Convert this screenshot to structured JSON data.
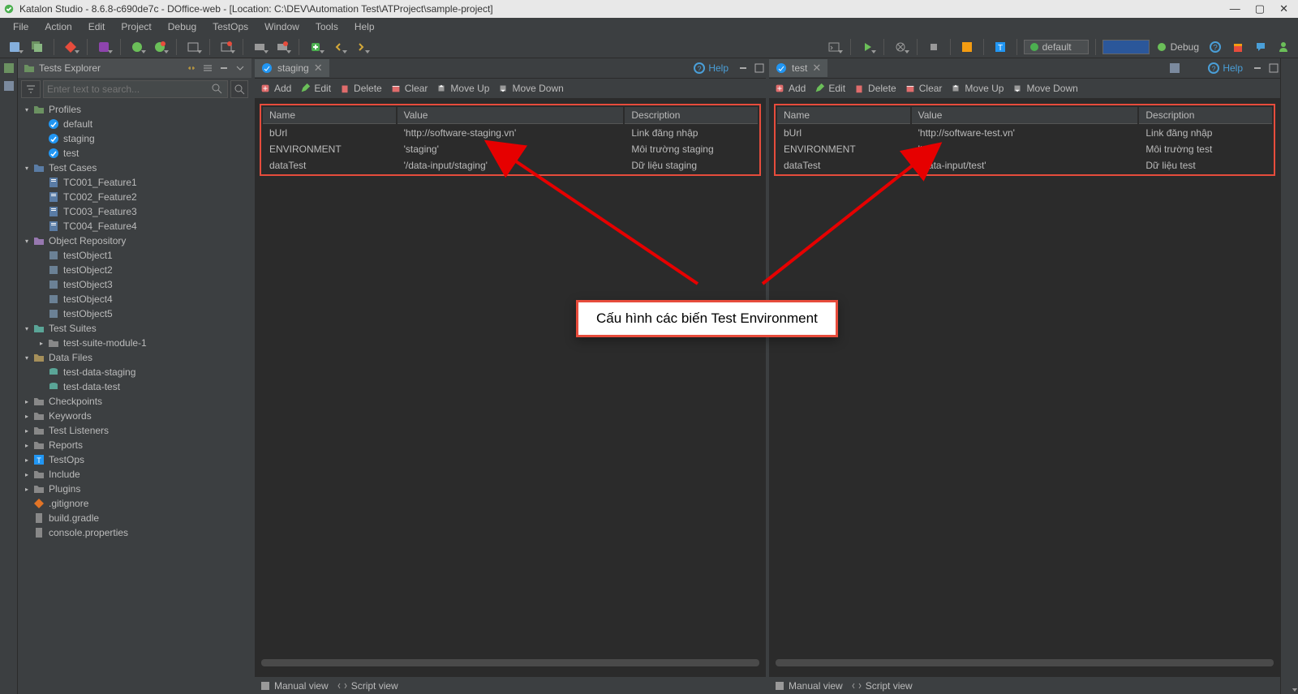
{
  "title": "Katalon Studio - 8.6.8-c690de7c - DOffice-web - [Location: C:\\DEV\\Automation Test\\ATProject\\sample-project]",
  "menubar": [
    "File",
    "Action",
    "Edit",
    "Project",
    "Debug",
    "TestOps",
    "Window",
    "Tools",
    "Help"
  ],
  "toolbar": {
    "profile_selected": "default",
    "debug_label": "Debug"
  },
  "explorer": {
    "title": "Tests Explorer",
    "search_placeholder": "Enter text to search...",
    "tree": [
      {
        "d": 0,
        "exp": "v",
        "icon": "folder-green",
        "label": "Profiles"
      },
      {
        "d": 1,
        "exp": "",
        "icon": "profile",
        "label": "default"
      },
      {
        "d": 1,
        "exp": "",
        "icon": "profile",
        "label": "staging"
      },
      {
        "d": 1,
        "exp": "",
        "icon": "profile",
        "label": "test"
      },
      {
        "d": 0,
        "exp": "v",
        "icon": "folder-blue",
        "label": "Test Cases"
      },
      {
        "d": 1,
        "exp": "",
        "icon": "tc",
        "label": "TC001_Feature1"
      },
      {
        "d": 1,
        "exp": "",
        "icon": "tc",
        "label": "TC002_Feature2"
      },
      {
        "d": 1,
        "exp": "",
        "icon": "tc",
        "label": "TC003_Feature3"
      },
      {
        "d": 1,
        "exp": "",
        "icon": "tc",
        "label": "TC004_Feature4"
      },
      {
        "d": 0,
        "exp": "v",
        "icon": "folder-purple",
        "label": "Object Repository"
      },
      {
        "d": 1,
        "exp": "",
        "icon": "obj",
        "label": "testObject1"
      },
      {
        "d": 1,
        "exp": "",
        "icon": "obj",
        "label": "testObject2"
      },
      {
        "d": 1,
        "exp": "",
        "icon": "obj",
        "label": "testObject3"
      },
      {
        "d": 1,
        "exp": "",
        "icon": "obj",
        "label": "testObject4"
      },
      {
        "d": 1,
        "exp": "",
        "icon": "obj",
        "label": "testObject5"
      },
      {
        "d": 0,
        "exp": "v",
        "icon": "folder-teal",
        "label": "Test Suites"
      },
      {
        "d": 1,
        "exp": ">",
        "icon": "folder",
        "label": "test-suite-module-1"
      },
      {
        "d": 0,
        "exp": "v",
        "icon": "folder-tan",
        "label": "Data Files"
      },
      {
        "d": 1,
        "exp": "",
        "icon": "data",
        "label": "test-data-staging"
      },
      {
        "d": 1,
        "exp": "",
        "icon": "data",
        "label": "test-data-test"
      },
      {
        "d": 0,
        "exp": ">",
        "icon": "folder-grey",
        "label": "Checkpoints"
      },
      {
        "d": 0,
        "exp": ">",
        "icon": "folder-grey",
        "label": "Keywords"
      },
      {
        "d": 0,
        "exp": ">",
        "icon": "folder-grey",
        "label": "Test Listeners"
      },
      {
        "d": 0,
        "exp": ">",
        "icon": "folder-grey",
        "label": "Reports"
      },
      {
        "d": 0,
        "exp": ">",
        "icon": "testops",
        "label": "TestOps"
      },
      {
        "d": 0,
        "exp": ">",
        "icon": "folder-grey",
        "label": "Include"
      },
      {
        "d": 0,
        "exp": ">",
        "icon": "folder-grey",
        "label": "Plugins"
      },
      {
        "d": 0,
        "exp": "",
        "icon": "git",
        "label": ".gitignore"
      },
      {
        "d": 0,
        "exp": "",
        "icon": "file",
        "label": "build.gradle"
      },
      {
        "d": 0,
        "exp": "",
        "icon": "file",
        "label": "console.properties"
      }
    ]
  },
  "panes": [
    {
      "tab": "staging",
      "help": "Help",
      "toolbar": [
        "Add",
        "Edit",
        "Delete",
        "Clear",
        "Move Up",
        "Move Down"
      ],
      "cols": [
        "Name",
        "Value",
        "Description"
      ],
      "rows": [
        [
          "bUrl",
          "'http://software-staging.vn'",
          "Link đăng nhập"
        ],
        [
          "ENVIRONMENT",
          "'staging'",
          "Môi trường staging"
        ],
        [
          "dataTest",
          "'/data-input/staging'",
          "Dữ liệu staging"
        ]
      ],
      "footer": [
        "Manual view",
        "Script view"
      ]
    },
    {
      "tab": "test",
      "help": "Help",
      "toolbar": [
        "Add",
        "Edit",
        "Delete",
        "Clear",
        "Move Up",
        "Move Down"
      ],
      "cols": [
        "Name",
        "Value",
        "Description"
      ],
      "rows": [
        [
          "bUrl",
          "'http://software-test.vn'",
          "Link đăng nhập"
        ],
        [
          "ENVIRONMENT",
          "'test'",
          "Môi trường test"
        ],
        [
          "dataTest",
          "'/data-input/test'",
          "Dữ liệu test"
        ]
      ],
      "footer": [
        "Manual view",
        "Script view"
      ]
    }
  ],
  "callout": "Cấu hình các biến Test Environment"
}
